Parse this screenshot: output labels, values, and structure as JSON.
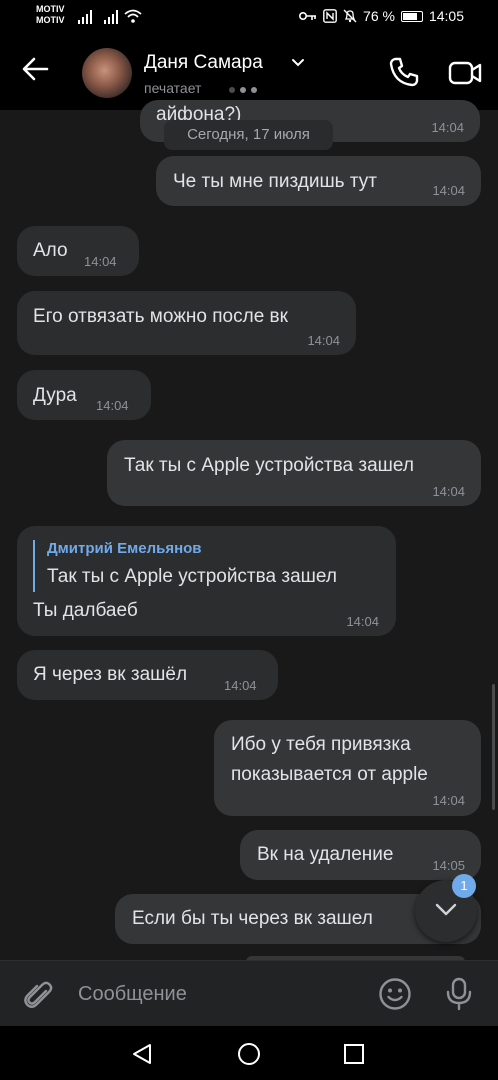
{
  "status_bar": {
    "carrier_1": "MOTIV",
    "carrier_2": "MOTIV",
    "battery_text": "76 %",
    "battery_level": 0.76,
    "time": "14:05"
  },
  "header": {
    "contact_name": "Даня Самара",
    "status": "печатает"
  },
  "chat": {
    "cut_off_text": "айфона?)",
    "cut_off_time": "14:04",
    "date_separator": "Сегодня, 17 июля",
    "messages": [
      {
        "text": "Че ты мне пиздишь тут",
        "time": "14:04",
        "direction": "out"
      },
      {
        "text": "Ало",
        "time": "14:04",
        "direction": "in"
      },
      {
        "text": "Его отвязать можно после вк",
        "time": "14:04",
        "direction": "in"
      },
      {
        "text": "Дура",
        "time": "14:04",
        "direction": "in"
      },
      {
        "text": "Так ты с Apple устройства зашел",
        "time": "14:04",
        "direction": "out"
      },
      {
        "reply_author": "Дмитрий Емельянов",
        "reply_text": "Так ты с Apple устройства зашел",
        "text": "Ты далбаеб",
        "time": "14:04",
        "direction": "in"
      },
      {
        "text": "Я через вк зашёл",
        "time": "14:04",
        "direction": "in"
      },
      {
        "line1": "Ибо у тебя привязка",
        "line2": "показывается от apple",
        "time": "14:04",
        "direction": "out"
      },
      {
        "text": "Вк на удаление",
        "time": "14:05",
        "direction": "out"
      },
      {
        "text": "Если бы ты через вк зашел",
        "direction": "out"
      }
    ]
  },
  "scroll_down": {
    "unread_count": "1"
  },
  "composer": {
    "placeholder": "Сообщение"
  },
  "colors": {
    "accent": "#71aaeb",
    "background": "#19191a",
    "bubble": "#2c2d2e"
  }
}
